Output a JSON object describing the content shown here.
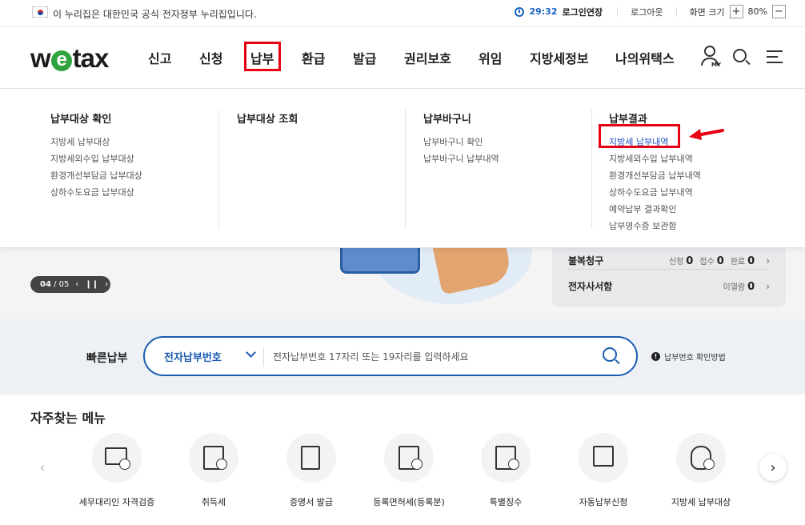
{
  "gov_bar": {
    "notice": "이 누리집은 대한민국 공식 전자정부 누리집입니다.",
    "timer": "29:32",
    "extend": "로그인연장",
    "logout": "로그아웃",
    "zoom_label": "화면 크기",
    "zoom_in": "+",
    "zoom_level": "80%",
    "zoom_out": "−"
  },
  "header": {
    "logo_w": "w",
    "logo_e": "e",
    "logo_rest": "tax",
    "nav": [
      "신고",
      "신청",
      "납부",
      "환급",
      "발급",
      "권리보호",
      "위임",
      "지방세정보",
      "나의위택스"
    ],
    "active_nav": "납부",
    "my_label": "MY"
  },
  "mega_menu": {
    "columns": [
      {
        "title": "납부대상 확인",
        "items": [
          "지방세 납부대상",
          "지방세외수입 납부대상",
          "환경개선부담금 납부대상",
          "상하수도요금 납부대상"
        ]
      },
      {
        "title": "납부대상 조회",
        "items": []
      },
      {
        "title": "납부바구니",
        "items": [
          "납부바구니 확인",
          "납부바구니 납부내역"
        ]
      },
      {
        "title": "납부결과",
        "items": [
          "지방세 납부내역",
          "지방세외수입 납부내역",
          "환경개선부담금 납부내역",
          "상하수도요금 납부내역",
          "예약납부 결과확인",
          "납부영수증 보관함"
        ]
      }
    ],
    "highlighted_item": "지방세 납부내역",
    "highlight_color": "#e60012"
  },
  "hero": {
    "slide_current": "04",
    "slide_total": "/ 05",
    "status": [
      {
        "label": "불복청구",
        "stats": [
          [
            "신청",
            "0"
          ],
          [
            "접수",
            "0"
          ],
          [
            "완료",
            "0"
          ]
        ]
      },
      {
        "label": "전자사서함",
        "stats": [
          [
            "미열람",
            "0"
          ]
        ]
      }
    ]
  },
  "quick_pay": {
    "label": "빠른납부",
    "select_value": "전자납부번호",
    "placeholder": "전자납부번호 17자리 또는 19자리를 입력하세요",
    "help": "납부번호 확인방법"
  },
  "frequent": {
    "title": "자주찾는 메뉴",
    "items": [
      {
        "label": "세무대리인 자격검증",
        "icon": "monitor-check-icon"
      },
      {
        "label": "취득세",
        "icon": "box-won-icon"
      },
      {
        "label": "증명서 발급",
        "icon": "certificate-icon"
      },
      {
        "label": "등록면허세(등록분)",
        "icon": "clipboard-won-icon"
      },
      {
        "label": "특별징수",
        "icon": "folder-check-icon"
      },
      {
        "label": "자동납부신청",
        "icon": "auto-pay-icon"
      },
      {
        "label": "지방세 납부대상",
        "icon": "money-bag-check-icon"
      }
    ]
  },
  "colors": {
    "brand_green": "#2fa33f",
    "primary_blue": "#1a5bb0",
    "highlight_red": "#e60012"
  }
}
